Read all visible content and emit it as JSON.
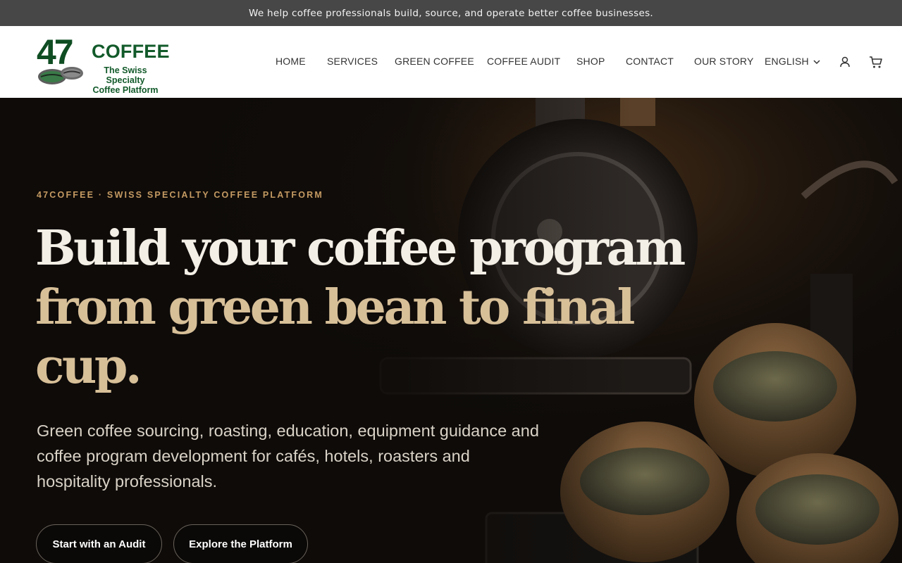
{
  "announcement": "We help coffee professionals build, source, and operate better coffee businesses.",
  "logo": {
    "number": "47",
    "word": "COFFEE",
    "tagline_line1": "The Swiss Specialty",
    "tagline_line2": "Coffee Platform"
  },
  "nav": {
    "items": [
      "HOME",
      "SERVICES",
      "GREEN COFFEE",
      "COFFEE AUDIT",
      "SHOP",
      "CONTACT",
      "OUR STORY"
    ],
    "language": "ENGLISH",
    "icons": [
      "chevron-down-icon",
      "user-icon",
      "cart-icon"
    ]
  },
  "hero": {
    "eyebrow": "47COFFEE · SWISS SPECIALTY COFFEE PLATFORM",
    "headline_line1": "Build your coffee program",
    "headline_line2": "from green bean to final",
    "headline_line3": "cup.",
    "subtitle": "Green coffee sourcing, roasting, education, equipment guidance and coffee program development for cafés, hotels, roasters and hospitality professionals.",
    "buttons": {
      "primary": "Start with an Audit",
      "secondary": "Explore the Platform"
    }
  },
  "colors": {
    "announcement_bg": "#474747",
    "brand_green": "#125a2a",
    "hero_bg": "#0e0b09",
    "eyebrow": "#c49a62",
    "headline_light": "#f4efe6",
    "headline_accent": "#d7bf98"
  }
}
